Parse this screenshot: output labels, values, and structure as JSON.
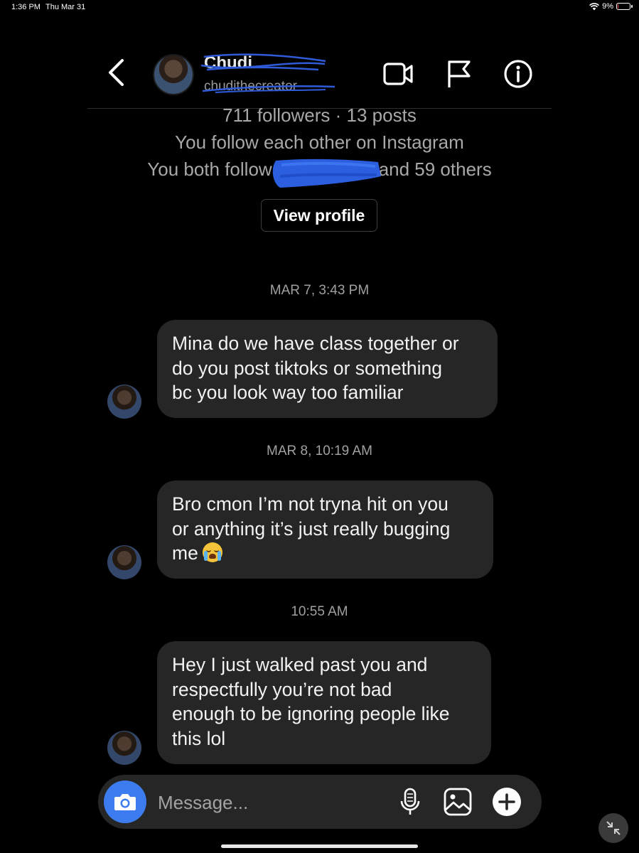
{
  "status_bar": {
    "time": "1:36 PM",
    "date": "Thu Mar 31",
    "battery_percent": "9%",
    "battery_level": 0.09
  },
  "header": {
    "name": "Chudi",
    "username": "chudithecreator",
    "icons": [
      "back-icon",
      "video-call-icon",
      "flag-icon",
      "info-icon"
    ]
  },
  "profile_info": {
    "stats": "711 followers · 13 posts",
    "follow_status": "You follow each other on Instagram",
    "mutual_prefix": "You both follow",
    "mutual_suffix": "and 59 others",
    "view_profile_label": "View profile"
  },
  "messages": [
    {
      "timestamp": "MAR 7, 3:43 PM",
      "lines": [
        "Mina do we have class together or",
        "do you post tiktoks or something",
        "bc you look way too familiar"
      ]
    },
    {
      "timestamp": "MAR 8, 10:19 AM",
      "lines": [
        "Bro cmon I’m not tryna hit on you",
        "or anything it’s just really bugging",
        "me"
      ],
      "trailing_emoji": "loudly-crying-face-emoji"
    },
    {
      "timestamp": "10:55 AM",
      "lines": [
        "Hey I just walked past you and",
        "respectfully you’re not bad",
        "enough to be ignoring people like",
        "this lol"
      ]
    }
  ],
  "composer": {
    "placeholder": "Message...",
    "icons": [
      "camera-icon",
      "microphone-icon",
      "gallery-icon",
      "plus-icon"
    ]
  },
  "colors": {
    "background": "#000000",
    "bubble": "#262626",
    "accent_blue": "#3d7bf0",
    "scribble_blue": "#2f5bd8",
    "battery_red": "#e8473b"
  }
}
